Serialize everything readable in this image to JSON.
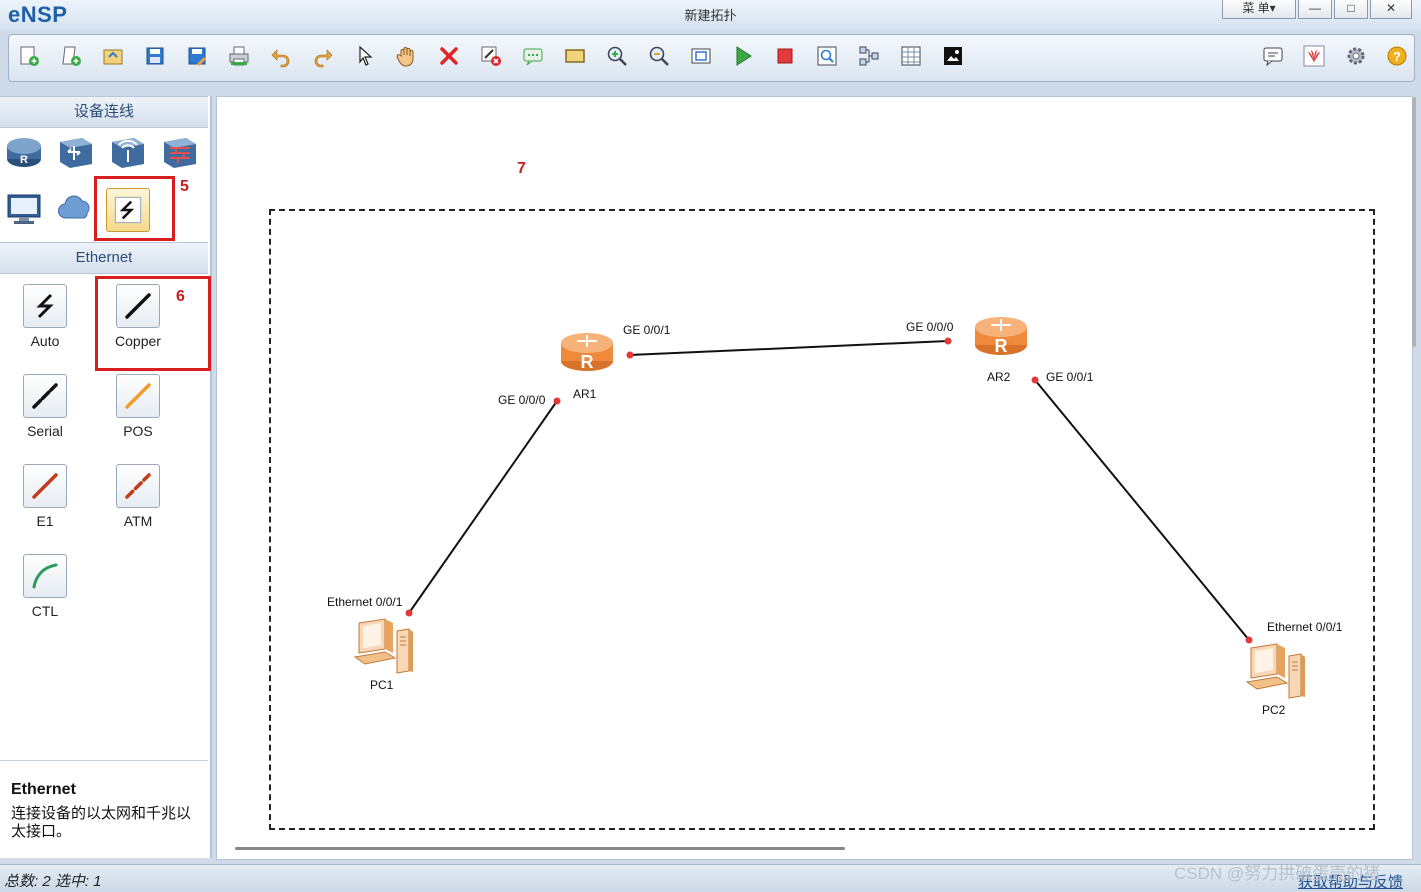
{
  "app": {
    "name": "eNSP",
    "window_title": "新建拓扑"
  },
  "window_controls": {
    "menu_label": "菜 单▾",
    "minimize": "—",
    "maximize": "□",
    "close": "✕"
  },
  "toolbar": {
    "buttons": [
      "new-topology",
      "new-lab",
      "open",
      "save",
      "save-as",
      "print",
      "undo",
      "redo",
      "select",
      "pan",
      "delete",
      "delete-links",
      "text",
      "rectangle",
      "zoom-in",
      "zoom-out",
      "fit-view",
      "start-devices",
      "stop-devices",
      "capture",
      "topology",
      "data-table",
      "screenshot"
    ],
    "right_buttons": [
      "chat",
      "huawei",
      "settings",
      "help"
    ]
  },
  "left_panel": {
    "section_title": "设备连线",
    "device_categories": [
      "router",
      "switch",
      "wireless",
      "firewall",
      "pc",
      "cloud",
      "cable"
    ],
    "cable_section_title": "Ethernet",
    "cables": [
      {
        "id": "auto",
        "label": "Auto"
      },
      {
        "id": "copper",
        "label": "Copper"
      },
      {
        "id": "serial",
        "label": "Serial"
      },
      {
        "id": "pos",
        "label": "POS"
      },
      {
        "id": "e1",
        "label": "E1"
      },
      {
        "id": "atm",
        "label": "ATM"
      },
      {
        "id": "ctl",
        "label": "CTL"
      }
    ],
    "description": {
      "title": "Ethernet",
      "text": "连接设备的以太网和千兆以太接口。"
    }
  },
  "annotations": {
    "a5": "5",
    "a6": "6",
    "a7": "7"
  },
  "topology": {
    "nodes": [
      {
        "id": "AR1",
        "label": "AR1",
        "type": "router"
      },
      {
        "id": "AR2",
        "label": "AR2",
        "type": "router"
      },
      {
        "id": "PC1",
        "label": "PC1",
        "type": "pc"
      },
      {
        "id": "PC2",
        "label": "PC2",
        "type": "pc"
      }
    ],
    "ports": {
      "ar1_ge001": "GE 0/0/1",
      "ar1_ge000": "GE 0/0/0",
      "ar2_ge000": "GE 0/0/0",
      "ar2_ge001": "GE 0/0/1",
      "pc1_eth": "Ethernet 0/0/1",
      "pc2_eth": "Ethernet 0/0/1"
    }
  },
  "status_bar": {
    "text": "总数: 2 选中: 1",
    "right_link": "获取帮助与反馈"
  },
  "watermark": "CSDN @努力拱破蛋壳的猪",
  "colors": {
    "router": "#f39a4c",
    "accent": "#1e5fa8",
    "highlight": "#d81e1e",
    "link": "#111111"
  }
}
